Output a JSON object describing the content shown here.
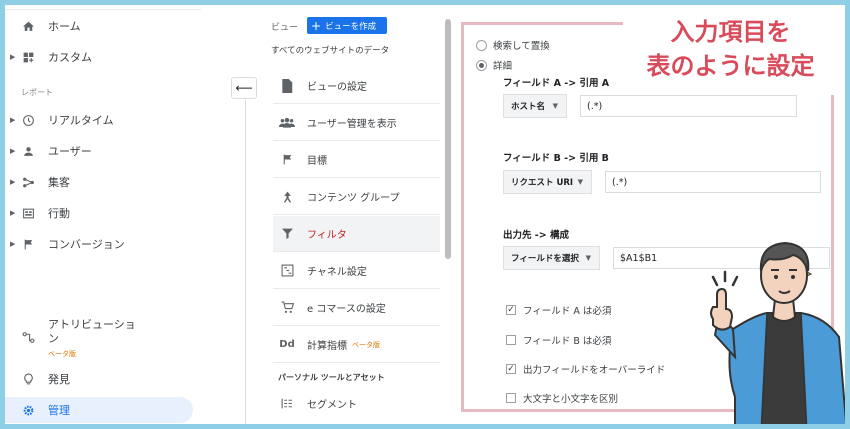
{
  "sidebar": {
    "items": [
      {
        "label": "ホーム",
        "icon": "home-icon"
      },
      {
        "label": "カスタム",
        "icon": "dashboard-icon"
      },
      {
        "label": "リアルタイム",
        "icon": "clock-icon"
      },
      {
        "label": "ユーザー",
        "icon": "person-icon"
      },
      {
        "label": "集客",
        "icon": "acquisition-icon"
      },
      {
        "label": "行動",
        "icon": "behavior-icon"
      },
      {
        "label": "コンバージョン",
        "icon": "flag-icon"
      }
    ],
    "section_reports": "レポート",
    "attribution_label_1": "アトリビューショ",
    "attribution_label_2": "ン",
    "attribution_beta": "ベータ版",
    "discover": "発見",
    "admin": "管理"
  },
  "middle": {
    "header": "ビュー",
    "create_button": "ビューを作成",
    "subtitle": "すべてのウェブサイトのデータ",
    "menu": [
      {
        "label": "ビューの設定"
      },
      {
        "label": "ユーザー管理を表示"
      },
      {
        "label": "目標"
      },
      {
        "label": "コンテンツ グループ"
      },
      {
        "label": "フィルタ"
      },
      {
        "label": "チャネル設定"
      },
      {
        "label": "e コマースの設定"
      },
      {
        "label": "計算指標"
      }
    ],
    "calc_beta": "ベータ版",
    "section_personal": "パーソナル ツールとアセット",
    "segment": "セグメント"
  },
  "right": {
    "radio_search_replace": "検索して置換",
    "radio_advanced": "詳細",
    "field_a_title": "フィールド A -> 引用 A",
    "field_a_select": "ホスト名",
    "field_a_value": "(.*)",
    "field_b_title": "フィールド B -> 引用 B",
    "field_b_select": "リクエスト URI",
    "field_b_value": "(.*)",
    "output_title": "出力先 -> 構成",
    "output_select": "フィールドを選択",
    "output_value": "$A1$B1",
    "check_a_required": "フィールド A は必須",
    "check_b_required": "フィールド B は必須",
    "check_override": "出力フィールドをオーバーライド",
    "check_case": "大文字と小文字を区別"
  },
  "callout": {
    "line1": "入力項目を",
    "line2": "表のように設定"
  },
  "colors": {
    "accent": "#1a73e8",
    "callout": "#d94a5a",
    "box_border": "#e8b9c2",
    "background": "#8fcfe6"
  }
}
